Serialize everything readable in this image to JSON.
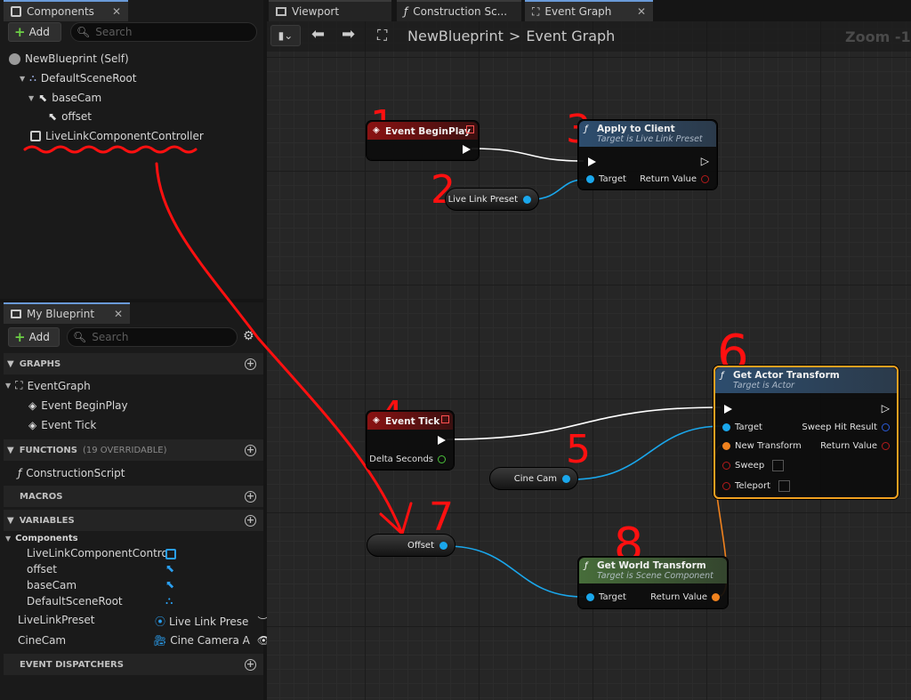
{
  "tabs": {
    "components": "Components",
    "viewport": "Viewport",
    "construction": "Construction Sc...",
    "event_graph": "Event Graph",
    "my_blueprint": "My Blueprint"
  },
  "components_panel": {
    "add_label": "Add",
    "search_placeholder": "Search",
    "tree": [
      "NewBlueprint (Self)",
      "DefaultSceneRoot",
      "baseCam",
      "offset",
      "LiveLinkComponentController"
    ]
  },
  "my_blueprint": {
    "add_label": "Add",
    "search_placeholder": "Search",
    "sections": {
      "graphs": "GRAPHS",
      "functions": "FUNCTIONS",
      "functions_sub": "(19 OVERRIDABLE)",
      "macros": "MACROS",
      "variables": "VARIABLES",
      "event_dispatchers": "EVENT DISPATCHERS"
    },
    "graphs": [
      "EventGraph",
      "Event BeginPlay",
      "Event Tick"
    ],
    "functions": [
      "ConstructionScript"
    ],
    "components_label": "Components",
    "component_vars": [
      "LiveLinkComponentControlle",
      "offset",
      "baseCam",
      "DefaultSceneRoot"
    ],
    "variables": [
      {
        "name": "LiveLinkPreset",
        "type": "Live Link Prese"
      },
      {
        "name": "CineCam",
        "type": "Cine Camera A"
      }
    ]
  },
  "graph": {
    "breadcrumb_root": "NewBlueprint",
    "breadcrumb_sep": ">",
    "breadcrumb_current": "Event Graph",
    "zoom": "Zoom -1",
    "nodes": {
      "begin_play": {
        "title": "Event BeginPlay"
      },
      "apply_client": {
        "title": "Apply to Client",
        "subtitle": "Target is Live Link Preset",
        "pin_target": "Target",
        "pin_return": "Return Value"
      },
      "live_link_preset": {
        "label": "Live Link Preset"
      },
      "event_tick": {
        "title": "Event Tick",
        "pin_delta": "Delta Seconds"
      },
      "cine_cam": {
        "label": "Cine Cam"
      },
      "get_actor_transform": {
        "title": "Get Actor Transform",
        "subtitle": "Target is Actor",
        "pin_target": "Target",
        "pin_new_transform": "New Transform",
        "pin_sweep": "Sweep",
        "pin_teleport": "Teleport",
        "pin_sweep_hit": "Sweep Hit Result",
        "pin_return": "Return Value"
      },
      "offset": {
        "label": "Offset"
      },
      "get_world_transform": {
        "title": "Get World Transform",
        "subtitle": "Target is Scene Component",
        "pin_target": "Target",
        "pin_return": "Return Value"
      }
    },
    "annotations": [
      "1",
      "2",
      "3",
      "4",
      "5",
      "6",
      "7",
      "8"
    ],
    "colors": {
      "accent_selected": "#f0a020",
      "annotation": "#ff1010",
      "exec_wire": "#ffffff",
      "object_wire": "#1aa7ec",
      "struct_wire": "#f0821e"
    }
  }
}
